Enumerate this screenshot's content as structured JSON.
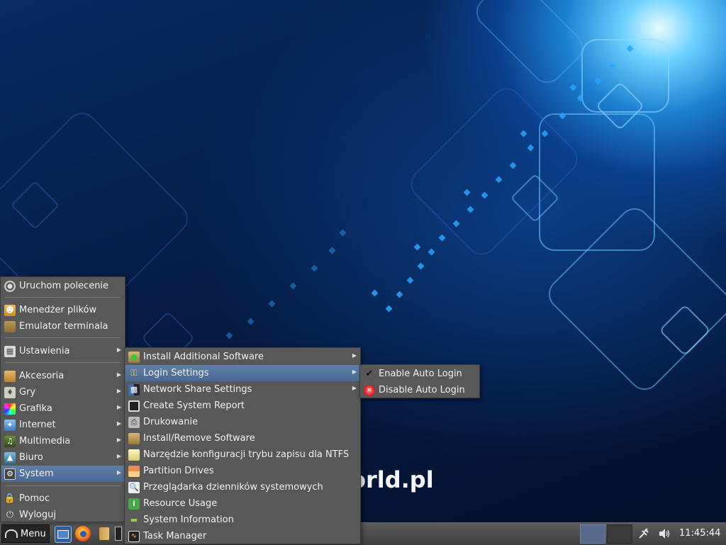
{
  "wallpaper": {
    "logo_text": "orld.pl"
  },
  "main_menu": {
    "items": [
      {
        "label": "Uruchom polecenie",
        "icon": "run-icon"
      },
      {
        "label": "Menedżer plików",
        "icon": "file-manager-icon"
      },
      {
        "label": "Emulator terminala",
        "icon": "terminal-icon"
      },
      {
        "label": "Ustawienia",
        "icon": "settings-icon"
      },
      {
        "label": "Akcesoria",
        "icon": "accessories-icon"
      },
      {
        "label": "Gry",
        "icon": "games-icon"
      },
      {
        "label": "Grafika",
        "icon": "graphics-icon"
      },
      {
        "label": "Internet",
        "icon": "internet-icon"
      },
      {
        "label": "Multimedia",
        "icon": "multimedia-icon"
      },
      {
        "label": "Biuro",
        "icon": "office-icon"
      },
      {
        "label": "System",
        "icon": "system-icon"
      },
      {
        "label": "Pomoc",
        "icon": "help-icon"
      },
      {
        "label": "Wyloguj",
        "icon": "logout-icon"
      }
    ]
  },
  "system_menu": {
    "items": [
      {
        "label": "Install Additional Software"
      },
      {
        "label": "Login Settings"
      },
      {
        "label": "Network Share Settings"
      },
      {
        "label": "Create System Report"
      },
      {
        "label": "Drukowanie"
      },
      {
        "label": "Install/Remove Software"
      },
      {
        "label": "Narzędzie konfiguracji trybu zapisu dla NTFS"
      },
      {
        "label": "Partition Drives"
      },
      {
        "label": "Przeglądarka dzienników systemowych"
      },
      {
        "label": "Resource Usage"
      },
      {
        "label": "System Information"
      },
      {
        "label": "Task Manager"
      }
    ]
  },
  "login_menu": {
    "items": [
      {
        "label": "Enable Auto Login",
        "icon": "checkmark-icon"
      },
      {
        "label": "Disable Auto Login",
        "icon": "disable-icon"
      }
    ]
  },
  "panel": {
    "menu_label": "Menu",
    "clock": "11:45:44"
  },
  "colors": {
    "menu_bg": "#585858",
    "highlight": "#5a7aa4",
    "panel_bg": "#4a4a4a"
  }
}
